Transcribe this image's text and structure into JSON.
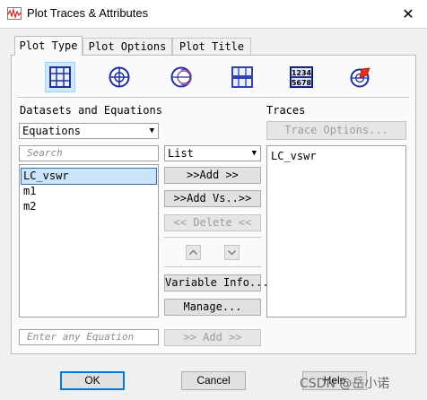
{
  "window": {
    "title": "Plot Traces & Attributes",
    "close_glyph": "✕",
    "app_icon": "waveform-icon"
  },
  "tabs": [
    {
      "label": "Plot Type",
      "active": true
    },
    {
      "label": "Plot Options",
      "active": false
    },
    {
      "label": "Plot Title",
      "active": false
    }
  ],
  "plot_types": [
    {
      "icon": "rectangular-grid-icon",
      "selected": true
    },
    {
      "icon": "polar-chart-icon",
      "selected": false
    },
    {
      "icon": "smith-chart-icon",
      "selected": false
    },
    {
      "icon": "stacked-rectangular-icon",
      "selected": false
    },
    {
      "icon": "numeric-table-icon",
      "text1": "1234",
      "text2": "5678",
      "selected": false
    },
    {
      "icon": "antenna-pattern-icon",
      "selected": false
    }
  ],
  "datasets": {
    "heading": "Datasets and Equations",
    "source_value": "Equations",
    "search_placeholder": "Search",
    "items": [
      {
        "label": "LC_vswr",
        "selected": true
      },
      {
        "label": "m1",
        "selected": false
      },
      {
        "label": "m2",
        "selected": false
      }
    ],
    "equation_placeholder": "Enter any Equation"
  },
  "middle": {
    "view_value": "List",
    "add_label": ">>Add >>",
    "add_vs_label": ">>Add Vs..>>",
    "delete_label": "<< Delete <<",
    "up_glyph": "⌃",
    "down_glyph": "⌄",
    "variable_info_label": "Variable Info...",
    "manage_label": "Manage...",
    "add_equation_label": ">> Add >>"
  },
  "traces": {
    "heading": "Traces",
    "options_label": "Trace Options...",
    "items": [
      {
        "label": "LC_vswr"
      }
    ]
  },
  "footer": {
    "ok_label": "OK",
    "cancel_label": "Cancel",
    "help_label": "Help"
  },
  "watermark": "CSDN @岳小诺"
}
